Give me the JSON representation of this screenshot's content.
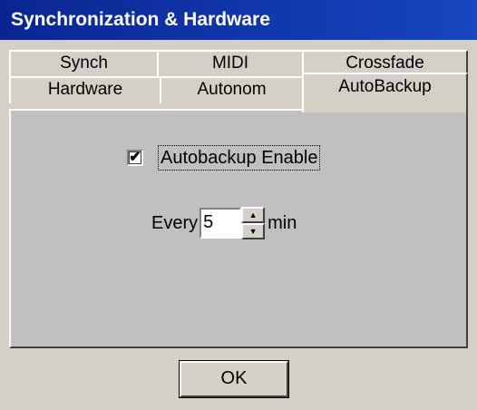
{
  "window": {
    "title": "Synchronization & Hardware"
  },
  "tabs": {
    "row1": [
      {
        "label": "Synch"
      },
      {
        "label": "MIDI"
      },
      {
        "label": "Crossfade"
      }
    ],
    "row2": [
      {
        "label": "Hardware"
      },
      {
        "label": "Autonom"
      },
      {
        "label": "AutoBackup"
      }
    ],
    "active": "AutoBackup"
  },
  "autobackup": {
    "enable_label": "Autobackup Enable",
    "enable_checked": true,
    "check_mark": "✔",
    "every_label": "Every",
    "interval_value": "5",
    "unit_label": "min",
    "spin_up": "▲",
    "spin_down": "▼"
  },
  "buttons": {
    "ok_label": "OK"
  },
  "colors": {
    "title_bar": "#0b2d9e",
    "face": "#d4d0c8",
    "panel": "#c0c0c0"
  }
}
